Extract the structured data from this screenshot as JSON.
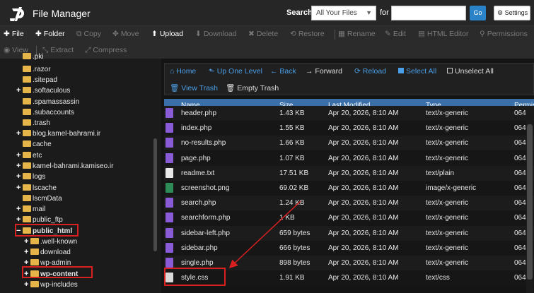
{
  "header": {
    "title": "File Manager",
    "search_label": "Search",
    "search_scope": "All Your Files",
    "for_label": "for",
    "search_value": "",
    "go_label": "Go",
    "settings_label": "Settings"
  },
  "toolbar": {
    "row1": [
      {
        "label": "File",
        "icon": "plus-icon",
        "enabled": true
      },
      {
        "label": "Folder",
        "icon": "plus-icon",
        "enabled": true
      },
      {
        "label": "Copy",
        "icon": "copy-icon",
        "enabled": false
      },
      {
        "label": "Move",
        "icon": "move-icon",
        "enabled": false
      },
      {
        "label": "Upload",
        "icon": "upload-icon",
        "enabled": true
      },
      {
        "label": "Download",
        "icon": "download-icon",
        "enabled": false
      },
      {
        "label": "Delete",
        "icon": "delete-icon",
        "enabled": false
      },
      {
        "label": "Restore",
        "icon": "restore-icon",
        "enabled": false
      },
      {
        "label": "Rename",
        "icon": "rename-icon",
        "enabled": false
      },
      {
        "label": "Edit",
        "icon": "pencil-icon",
        "enabled": false
      },
      {
        "label": "HTML Editor",
        "icon": "html-editor-icon",
        "enabled": false
      },
      {
        "label": "Permissions",
        "icon": "key-icon",
        "enabled": false
      }
    ],
    "row2": [
      {
        "label": "View",
        "icon": "eye-icon",
        "enabled": false
      },
      {
        "label": "Extract",
        "icon": "extract-icon",
        "enabled": false
      },
      {
        "label": "Compress",
        "icon": "compress-icon",
        "enabled": false
      }
    ]
  },
  "tree": {
    "items": [
      {
        "label": ".pki",
        "expander": ""
      },
      {
        "label": ".razor",
        "expander": ""
      },
      {
        "label": ".sitepad",
        "expander": ""
      },
      {
        "label": ".softaculous",
        "expander": "+"
      },
      {
        "label": ".spamassassin",
        "expander": ""
      },
      {
        "label": ".subaccounts",
        "expander": ""
      },
      {
        "label": ".trash",
        "expander": ""
      },
      {
        "label": "blog.kamel-bahrami.ir",
        "expander": "+"
      },
      {
        "label": "cache",
        "expander": ""
      },
      {
        "label": "etc",
        "expander": "+"
      },
      {
        "label": "kamel-bahrami.kamiseo.ir",
        "expander": "+"
      },
      {
        "label": "logs",
        "expander": "+"
      },
      {
        "label": "lscache",
        "expander": "+"
      },
      {
        "label": "lscmData",
        "expander": ""
      },
      {
        "label": "mail",
        "expander": "+"
      },
      {
        "label": "public_ftp",
        "expander": "+"
      },
      {
        "label": "public_html",
        "expander": "−"
      },
      {
        "label": ".well-known",
        "expander": "+"
      },
      {
        "label": "download",
        "expander": "+"
      },
      {
        "label": "wp-admin",
        "expander": "+"
      },
      {
        "label": "wp-content",
        "expander": "+"
      },
      {
        "label": "wp-includes",
        "expander": "+"
      }
    ]
  },
  "nav": {
    "home": "Home",
    "up": "Up One Level",
    "back": "Back",
    "forward": "Forward",
    "reload": "Reload",
    "select_all": "Select All",
    "unselect_all": "Unselect All",
    "view_trash": "View Trash",
    "empty_trash": "Empty Trash"
  },
  "table": {
    "columns": [
      "Name",
      "Size",
      "Last Modified",
      "Type",
      "Permis"
    ],
    "rows": [
      {
        "name": "header.php",
        "size": "1.43 KB",
        "modified": "Apr 20, 2026, 8:10 AM",
        "type": "text/x-generic",
        "perms": "064",
        "icon": "php"
      },
      {
        "name": "index.php",
        "size": "1.55 KB",
        "modified": "Apr 20, 2026, 8:10 AM",
        "type": "text/x-generic",
        "perms": "064",
        "icon": "php"
      },
      {
        "name": "no-results.php",
        "size": "1.66 KB",
        "modified": "Apr 20, 2026, 8:10 AM",
        "type": "text/x-generic",
        "perms": "064",
        "icon": "php"
      },
      {
        "name": "page.php",
        "size": "1.07 KB",
        "modified": "Apr 20, 2026, 8:10 AM",
        "type": "text/x-generic",
        "perms": "064",
        "icon": "php"
      },
      {
        "name": "readme.txt",
        "size": "17.51 KB",
        "modified": "Apr 20, 2026, 8:10 AM",
        "type": "text/plain",
        "perms": "064",
        "icon": "txt"
      },
      {
        "name": "screenshot.png",
        "size": "69.02 KB",
        "modified": "Apr 20, 2026, 8:10 AM",
        "type": "image/x-generic",
        "perms": "064",
        "icon": "img"
      },
      {
        "name": "search.php",
        "size": "1.24 KB",
        "modified": "Apr 20, 2026, 8:10 AM",
        "type": "text/x-generic",
        "perms": "064",
        "icon": "php"
      },
      {
        "name": "searchform.php",
        "size": "1 KB",
        "modified": "Apr 20, 2026, 8:10 AM",
        "type": "text/x-generic",
        "perms": "064",
        "icon": "php"
      },
      {
        "name": "sidebar-left.php",
        "size": "659 bytes",
        "modified": "Apr 20, 2026, 8:10 AM",
        "type": "text/x-generic",
        "perms": "064",
        "icon": "php"
      },
      {
        "name": "sidebar.php",
        "size": "666 bytes",
        "modified": "Apr 20, 2026, 8:10 AM",
        "type": "text/x-generic",
        "perms": "064",
        "icon": "php"
      },
      {
        "name": "single.php",
        "size": "898 bytes",
        "modified": "Apr 20, 2026, 8:10 AM",
        "type": "text/x-generic",
        "perms": "064",
        "icon": "php"
      },
      {
        "name": "style.css",
        "size": "1.91 KB",
        "modified": "Apr 20, 2026, 8:10 AM",
        "type": "text/css",
        "perms": "064",
        "icon": "css"
      }
    ]
  },
  "colors": {
    "accent": "#4a9fe8",
    "table_header": "#3a6fa8",
    "highlight": "#d92020",
    "folder": "#e6b54a"
  }
}
